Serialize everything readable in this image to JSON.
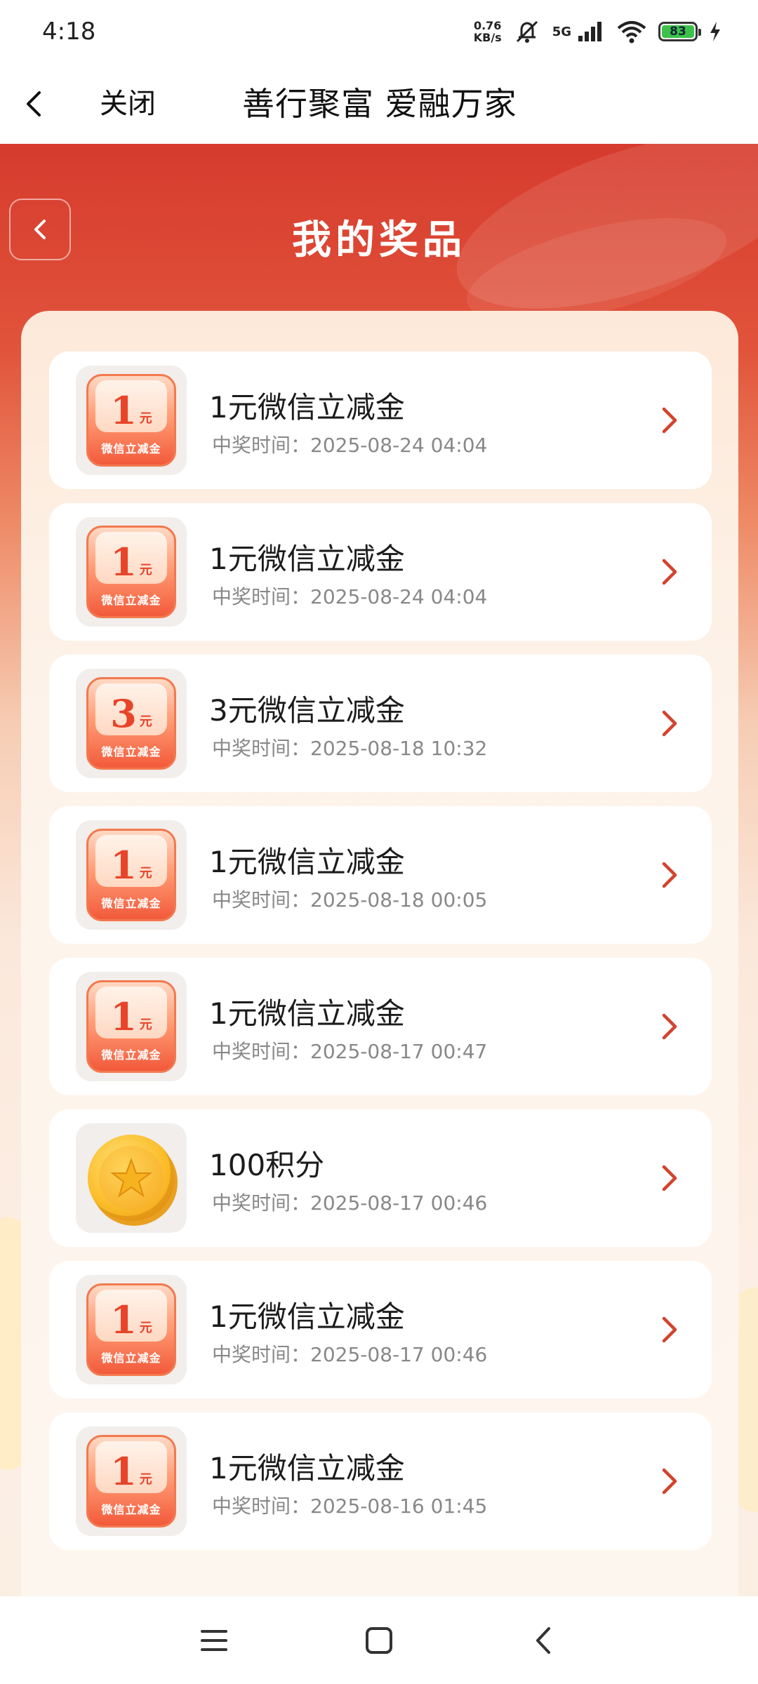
{
  "status_bar": {
    "time": "4:18",
    "net_speed_value": "0.76",
    "net_speed_unit": "KB/s",
    "network": "5G",
    "battery": "83"
  },
  "nav_bar": {
    "close_label": "关闭",
    "title": "善行聚富 爱融万家"
  },
  "page": {
    "title": "我的奖品"
  },
  "prizes": [
    {
      "name": "1元微信立减金",
      "time_label": "中奖时间：",
      "time": "2025-08-24 04:04",
      "type": "coupon",
      "amount": "1",
      "unit": "元",
      "caption": "微信立减金"
    },
    {
      "name": "1元微信立减金",
      "time_label": "中奖时间：",
      "time": "2025-08-24 04:04",
      "type": "coupon",
      "amount": "1",
      "unit": "元",
      "caption": "微信立减金"
    },
    {
      "name": "3元微信立减金",
      "time_label": "中奖时间：",
      "time": "2025-08-18 10:32",
      "type": "coupon",
      "amount": "3",
      "unit": "元",
      "caption": "微信立减金"
    },
    {
      "name": "1元微信立减金",
      "time_label": "中奖时间：",
      "time": "2025-08-18 00:05",
      "type": "coupon",
      "amount": "1",
      "unit": "元",
      "caption": "微信立减金"
    },
    {
      "name": "1元微信立减金",
      "time_label": "中奖时间：",
      "time": "2025-08-17 00:47",
      "type": "coupon",
      "amount": "1",
      "unit": "元",
      "caption": "微信立减金"
    },
    {
      "name": "100积分",
      "time_label": "中奖时间：",
      "time": "2025-08-17 00:46",
      "type": "coin"
    },
    {
      "name": "1元微信立减金",
      "time_label": "中奖时间：",
      "time": "2025-08-17 00:46",
      "type": "coupon",
      "amount": "1",
      "unit": "元",
      "caption": "微信立减金"
    },
    {
      "name": "1元微信立减金",
      "time_label": "中奖时间：",
      "time": "2025-08-16 01:45",
      "type": "coupon",
      "amount": "1",
      "unit": "元",
      "caption": "微信立减金"
    }
  ],
  "colors": {
    "header_red": "#d63b2d",
    "accent": "#e8442a",
    "chevron": "#d2432e"
  },
  "icons": {
    "nav_back": "chevron-left-icon",
    "page_back": "chevron-left-icon",
    "row_arrow": "chevron-right-icon",
    "points": "coin-star-icon",
    "sys_menu": "menu-icon",
    "sys_home": "home-square-icon",
    "sys_back": "back-triangle-icon"
  }
}
